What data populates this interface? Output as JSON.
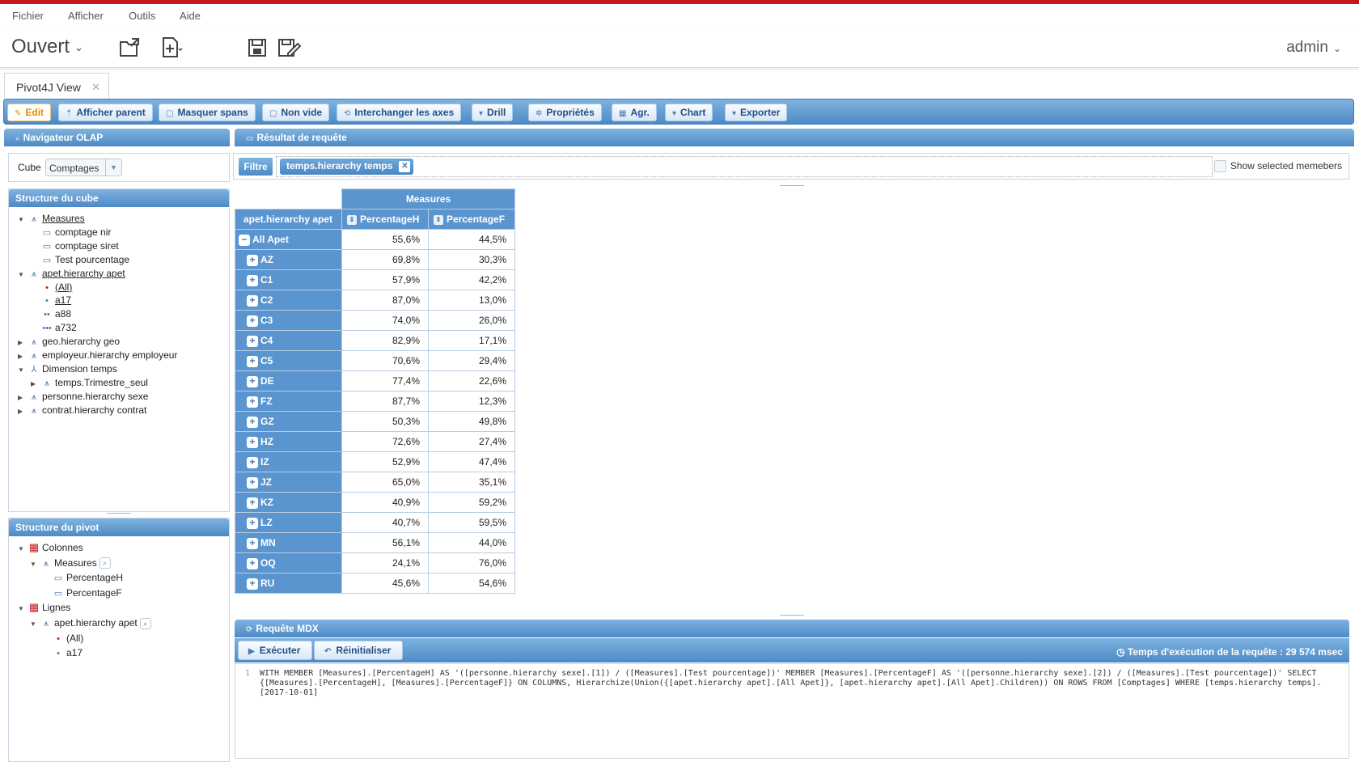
{
  "menu": [
    "Fichier",
    "Afficher",
    "Outils",
    "Aide"
  ],
  "toolbar": {
    "open_label": "Ouvert",
    "user": "admin"
  },
  "tab": {
    "label": "Pivot4J View"
  },
  "actions": [
    {
      "label": "Edit",
      "icon": "pencil-icon"
    },
    {
      "label": "Afficher parent",
      "icon": "arrow-up-icon"
    },
    {
      "label": "Masquer spans",
      "icon": "square-icon"
    },
    {
      "label": "Non vide",
      "icon": "square-icon"
    },
    {
      "label": "Interchanger les axes",
      "icon": "swap-icon"
    },
    {
      "label": "Drill",
      "icon": "caret-down-icon"
    },
    {
      "label": "Propriétés",
      "icon": "gear-icon"
    },
    {
      "label": "Agr.",
      "icon": "table-icon"
    },
    {
      "label": "Chart",
      "icon": "caret-down-icon"
    },
    {
      "label": "Exporter",
      "icon": "caret-down-icon"
    }
  ],
  "navigator": {
    "title": "Navigateur OLAP",
    "cube_label": "Cube",
    "cube_value": "Comptages",
    "structure_title": "Structure du cube",
    "tree": [
      {
        "label": "Measures",
        "level": 0,
        "toggle": "open",
        "icon": "hierarchy-icon",
        "underline": true
      },
      {
        "label": "comptage nir",
        "level": 1,
        "toggle": "",
        "icon": "ruler-icon"
      },
      {
        "label": "comptage siret",
        "level": 1,
        "toggle": "",
        "icon": "ruler-icon"
      },
      {
        "label": "Test pourcentage",
        "level": 1,
        "toggle": "",
        "icon": "ruler-icon"
      },
      {
        "label": "apet.hierarchy apet",
        "level": 0,
        "toggle": "open",
        "icon": "hierarchy-icon",
        "underline": true
      },
      {
        "label": "(All)",
        "level": 1,
        "toggle": "",
        "icon": "level-dot-red-icon",
        "underline": true
      },
      {
        "label": "a17",
        "level": 1,
        "toggle": "",
        "icon": "level-dot-icon",
        "underline": true
      },
      {
        "label": "a88",
        "level": 1,
        "toggle": "",
        "icon": "level-dots2-icon"
      },
      {
        "label": "a732",
        "level": 1,
        "toggle": "",
        "icon": "level-dots3-icon"
      },
      {
        "label": "geo.hierarchy geo",
        "level": 0,
        "toggle": "closed",
        "icon": "hierarchy-icon"
      },
      {
        "label": "employeur.hierarchy employeur",
        "level": 0,
        "toggle": "closed",
        "icon": "hierarchy-icon"
      },
      {
        "label": "Dimension temps",
        "level": 0,
        "toggle": "open",
        "icon": "dimension-icon"
      },
      {
        "label": "temps.Trimestre_seul",
        "level": 1,
        "toggle": "closed",
        "icon": "hierarchy-icon"
      },
      {
        "label": "personne.hierarchy sexe",
        "level": 0,
        "toggle": "closed",
        "icon": "hierarchy-icon"
      },
      {
        "label": "contrat.hierarchy contrat",
        "level": 0,
        "toggle": "closed",
        "icon": "hierarchy-icon"
      }
    ],
    "pivot_title": "Structure du pivot",
    "pivot_tree": [
      {
        "label": "Colonnes",
        "level": 0,
        "toggle": "open",
        "icon": "grid-icon"
      },
      {
        "label": "Measures",
        "level": 1,
        "toggle": "open",
        "icon": "hierarchy-icon",
        "mag": true
      },
      {
        "label": "PercentageH",
        "level": 2,
        "toggle": "",
        "icon": "ruler-icon"
      },
      {
        "label": "PercentageF",
        "level": 2,
        "toggle": "",
        "icon": "ruler-icon"
      },
      {
        "label": "Lignes",
        "level": 0,
        "toggle": "open",
        "icon": "grid-icon"
      },
      {
        "label": "apet.hierarchy apet",
        "level": 1,
        "toggle": "open",
        "icon": "hierarchy-icon",
        "mag": true
      },
      {
        "label": "(All)",
        "level": 2,
        "toggle": "",
        "icon": "level-dot-red-icon"
      },
      {
        "label": "a17",
        "level": 2,
        "toggle": "",
        "icon": "level-dot-icon"
      }
    ]
  },
  "result": {
    "title": "Résultat de requête",
    "filter_label": "Filtre",
    "filter_chip": "temps.hierarchy temps",
    "show_selected": "Show selected memebers",
    "table": {
      "measures_header": "Measures",
      "row_header": "apet.hierarchy apet",
      "columns": [
        "PercentageH",
        "PercentageF"
      ],
      "rows": [
        {
          "label": "All Apet",
          "expand": "−",
          "values": [
            "55,6%",
            "44,5%"
          ]
        },
        {
          "label": "AZ",
          "expand": "+",
          "values": [
            "69,8%",
            "30,3%"
          ]
        },
        {
          "label": "C1",
          "expand": "+",
          "values": [
            "57,9%",
            "42,2%"
          ]
        },
        {
          "label": "C2",
          "expand": "+",
          "values": [
            "87,0%",
            "13,0%"
          ]
        },
        {
          "label": "C3",
          "expand": "+",
          "values": [
            "74,0%",
            "26,0%"
          ]
        },
        {
          "label": "C4",
          "expand": "+",
          "values": [
            "82,9%",
            "17,1%"
          ]
        },
        {
          "label": "C5",
          "expand": "+",
          "values": [
            "70,6%",
            "29,4%"
          ]
        },
        {
          "label": "DE",
          "expand": "+",
          "values": [
            "77,4%",
            "22,6%"
          ]
        },
        {
          "label": "FZ",
          "expand": "+",
          "values": [
            "87,7%",
            "12,3%"
          ]
        },
        {
          "label": "GZ",
          "expand": "+",
          "values": [
            "50,3%",
            "49,8%"
          ]
        },
        {
          "label": "HZ",
          "expand": "+",
          "values": [
            "72,6%",
            "27,4%"
          ]
        },
        {
          "label": "IZ",
          "expand": "+",
          "values": [
            "52,9%",
            "47,4%"
          ]
        },
        {
          "label": "JZ",
          "expand": "+",
          "values": [
            "65,0%",
            "35,1%"
          ]
        },
        {
          "label": "KZ",
          "expand": "+",
          "values": [
            "40,9%",
            "59,2%"
          ]
        },
        {
          "label": "LZ",
          "expand": "+",
          "values": [
            "40,7%",
            "59,5%"
          ]
        },
        {
          "label": "MN",
          "expand": "+",
          "values": [
            "56,1%",
            "44,0%"
          ]
        },
        {
          "label": "OQ",
          "expand": "+",
          "values": [
            "24,1%",
            "76,0%"
          ]
        },
        {
          "label": "RU",
          "expand": "+",
          "values": [
            "45,6%",
            "54,6%"
          ]
        }
      ]
    }
  },
  "mdx": {
    "title": "Requête MDX",
    "execute_label": "Exécuter",
    "reset_label": "Réinitialiser",
    "exec_time": "Temps d'exécution de la requête : 29 574 msec",
    "line_number": "1",
    "query": "WITH MEMBER [Measures].[PercentageH] AS '([personne.hierarchy sexe].[1]) / ([Measures].[Test pourcentage])' MEMBER [Measures].[PercentageF] AS '([personne.hierarchy sexe].[2]) / ([Measures].[Test pourcentage])' SELECT {[Measures].[PercentageH], [Measures].[PercentageF]} ON COLUMNS, Hierarchize(Union({[apet.hierarchy apet].[All Apet]}, [apet.hierarchy apet].[All Apet].Children)) ON ROWS FROM [Comptages] WHERE [temps.hierarchy temps].[2017-10-01]"
  }
}
